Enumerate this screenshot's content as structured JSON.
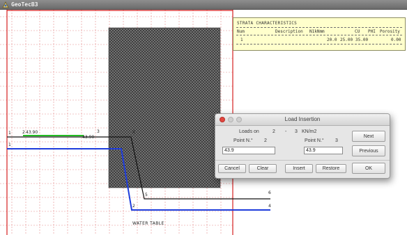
{
  "window": {
    "title": "GeoTecB3"
  },
  "strata": {
    "title": "STRATA CHARACTERISTICS",
    "columns": [
      "Num",
      "Description",
      "N1kNmm",
      "CU",
      "PHI",
      "Porosity"
    ],
    "rows": [
      {
        "num": "1",
        "description": "",
        "weight": "20.0",
        "cu": "25.00",
        "phi": "35.00",
        "porosity": "0.00"
      }
    ]
  },
  "drawing": {
    "points": [
      {
        "label": "1"
      },
      {
        "label": "2"
      },
      {
        "label": "3"
      },
      {
        "label": "4"
      },
      {
        "label": "5"
      },
      {
        "label": "6"
      }
    ],
    "values": [
      "43.90",
      "43.90"
    ],
    "water_table_label": "WATER TABLE",
    "colors": {
      "grid": "#e07878",
      "border": "#d62020",
      "water_line": "#1e3cdc",
      "load_line": "#22bb22",
      "profile_line": "#111111",
      "hatch_bg": "#6e6e6e"
    }
  },
  "dialog": {
    "title": "Load Insertion",
    "loads_on_label": "Loads on",
    "from_point": "2",
    "dash": "-",
    "to_point": "3",
    "unit": "KN/m2",
    "point_label_1": "Point N.°",
    "point_value_1": "2",
    "point_label_2": "Point N.°",
    "point_value_2": "3",
    "input_1": "43.9",
    "input_2": "43.9",
    "buttons": {
      "cancel": "Cancel",
      "clear": "Clear",
      "insert": "Insert",
      "restore": "Restore",
      "next": "Next",
      "previous": "Previous",
      "ok": "OK"
    }
  }
}
